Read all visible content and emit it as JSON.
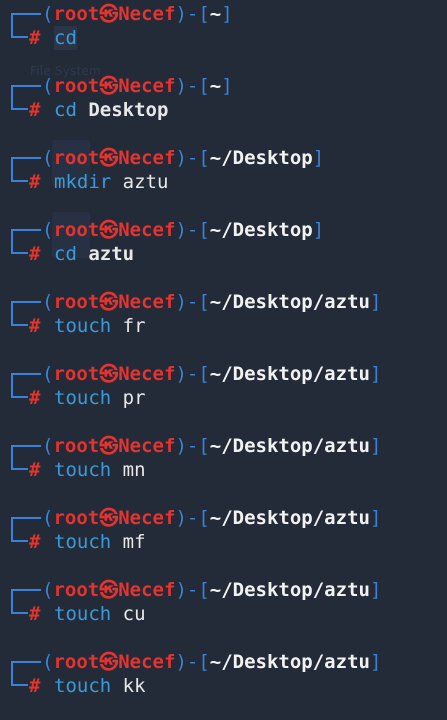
{
  "terminal": {
    "user": "root",
    "at_symbol": "㉿",
    "host": "Necef",
    "open_paren": "┌──(",
    "close_paren": ")",
    "dash": "-",
    "open_bracket": "[",
    "close_bracket": "]",
    "prompt_symbol": "#",
    "watermark": "File System",
    "entries": [
      {
        "path": "~",
        "command": "cd",
        "argument": "",
        "arg_bold": false
      },
      {
        "path": "~",
        "command": "cd",
        "argument": "Desktop",
        "arg_bold": true
      },
      {
        "path": "~/Desktop",
        "command": "mkdir",
        "argument": "aztu",
        "arg_bold": false
      },
      {
        "path": "~/Desktop",
        "command": "cd",
        "argument": "aztu",
        "arg_bold": true
      },
      {
        "path": "~/Desktop/aztu",
        "command": "touch",
        "argument": "fr",
        "arg_bold": false
      },
      {
        "path": "~/Desktop/aztu",
        "command": "touch",
        "argument": "pr",
        "arg_bold": false
      },
      {
        "path": "~/Desktop/aztu",
        "command": "touch",
        "argument": "mn",
        "arg_bold": false
      },
      {
        "path": "~/Desktop/aztu",
        "command": "touch",
        "argument": "mf",
        "arg_bold": false
      },
      {
        "path": "~/Desktop/aztu",
        "command": "touch",
        "argument": "cu",
        "arg_bold": false
      },
      {
        "path": "~/Desktop/aztu",
        "command": "touch",
        "argument": "kk",
        "arg_bold": false
      }
    ]
  },
  "colors": {
    "background": "#232a38",
    "prompt_frame": "#3b82d6",
    "user_host": "#e3342f",
    "path": "#f2f2f2",
    "command": "#3b9ad9"
  }
}
